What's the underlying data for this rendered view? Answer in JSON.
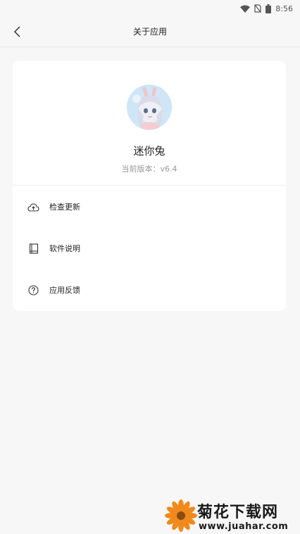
{
  "status_bar": {
    "time": "8:56",
    "icons": [
      "wifi-icon",
      "no-sim-icon",
      "battery-icon"
    ]
  },
  "header": {
    "title": "关于应用",
    "back_icon": "chevron-left-icon"
  },
  "app": {
    "name": "迷你兔",
    "version": "当前版本：v6.4"
  },
  "menu": [
    {
      "label": "检查更新",
      "icon": "cloud-upload-icon"
    },
    {
      "label": "软件说明",
      "icon": "book-icon"
    },
    {
      "label": "应用反馈",
      "icon": "question-circle-icon"
    }
  ],
  "watermark": {
    "title": "菊花下载网",
    "url": "www.juahar.com"
  },
  "colors": {
    "background": "#f7f7f7",
    "card": "#ffffff",
    "watermark_flower": "#f08a1c"
  }
}
